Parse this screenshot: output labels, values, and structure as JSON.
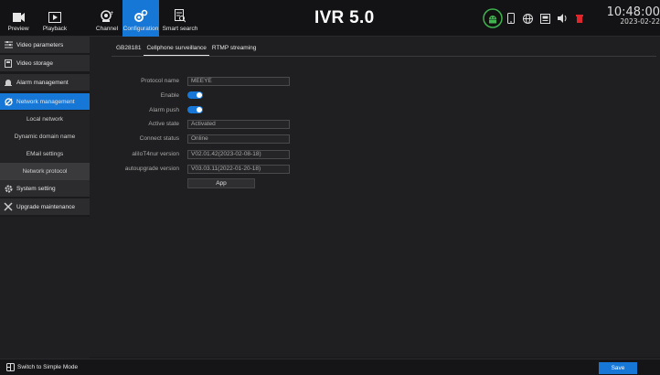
{
  "app": {
    "title": "IVR 5.0"
  },
  "nav": {
    "preview": "Preview",
    "playback": "Playback",
    "channel": "Channel",
    "configuration": "Configuration",
    "smart_search": "Smart search"
  },
  "clock": {
    "time": "10:48:00",
    "date": "2023-02-22"
  },
  "status_icons": [
    "android-icon",
    "phone-icon",
    "network-globe-icon",
    "storage-icon",
    "volume-icon",
    "record-alert-icon"
  ],
  "sidebar": {
    "items": [
      {
        "label": "Video parameters",
        "icon": "video-params-icon"
      },
      {
        "label": "Video storage",
        "icon": "storage-icon"
      },
      {
        "label": "Alarm management",
        "icon": "bell-icon"
      },
      {
        "label": "Network management",
        "icon": "network-icon"
      },
      {
        "label": "Local network"
      },
      {
        "label": "Dynamic domain name"
      },
      {
        "label": "EMail settings"
      },
      {
        "label": "Network protocol"
      },
      {
        "label": "System setting",
        "icon": "gear-icon"
      },
      {
        "label": "Upgrade maintenance",
        "icon": "tools-icon"
      }
    ]
  },
  "tabs": [
    "GB28181",
    "Cellphone surveillance",
    "RTMP streaming"
  ],
  "form": {
    "protocol_name_label": "Protocol name",
    "protocol_name_value": "MEEYE",
    "enable_label": "Enable",
    "enable_on": true,
    "alarm_push_label": "Alarm push",
    "alarm_push_on": true,
    "active_state_label": "Active state",
    "active_state_value": "Activated",
    "connect_status_label": "Connect status",
    "connect_status_value": "Online",
    "alilo_version_label": "aliIoT4nur version",
    "alilo_version_value": "V02.01.42(2023-02-08-18)",
    "autoupgrade_version_label": "autoupgrade version",
    "autoupgrade_version_value": "V03.03.11(2022-01-20-18)",
    "app_button": "App"
  },
  "footer": {
    "simple_mode": "Switch to Simple Mode",
    "save": "Save"
  },
  "colors": {
    "accent": "#1677d6",
    "background": "#1f1f21",
    "alert": "#e0262b",
    "online_green": "#3fb34f"
  }
}
